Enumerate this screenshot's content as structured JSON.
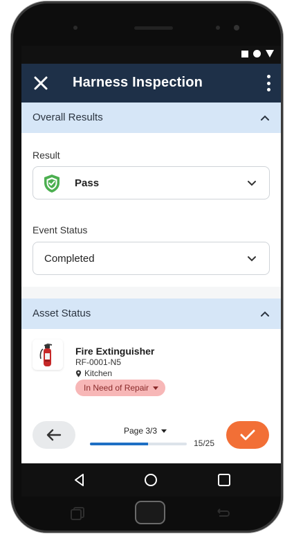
{
  "app": {
    "title": "Harness Inspection"
  },
  "overall_results": {
    "header": "Overall Results",
    "result_label": "Result",
    "result_value": "Pass",
    "event_status_label": "Event Status",
    "event_status_value": "Completed"
  },
  "asset_status": {
    "header": "Asset Status",
    "asset": {
      "name": "Fire Extinguisher",
      "id": "RF-0001-N5",
      "location": "Kitchen",
      "status": "In Need of Repair"
    }
  },
  "footer": {
    "page_label": "Page 3/3",
    "progress_count": "15/25",
    "progress_fraction": 0.6
  },
  "colors": {
    "app_bar": "#1e3048",
    "section_header": "#d6e6f7",
    "accent": "#f26f36",
    "progress": "#1e6fc4",
    "repair_badge": "#f7b7b7",
    "pass_shield": "#4caf50"
  }
}
